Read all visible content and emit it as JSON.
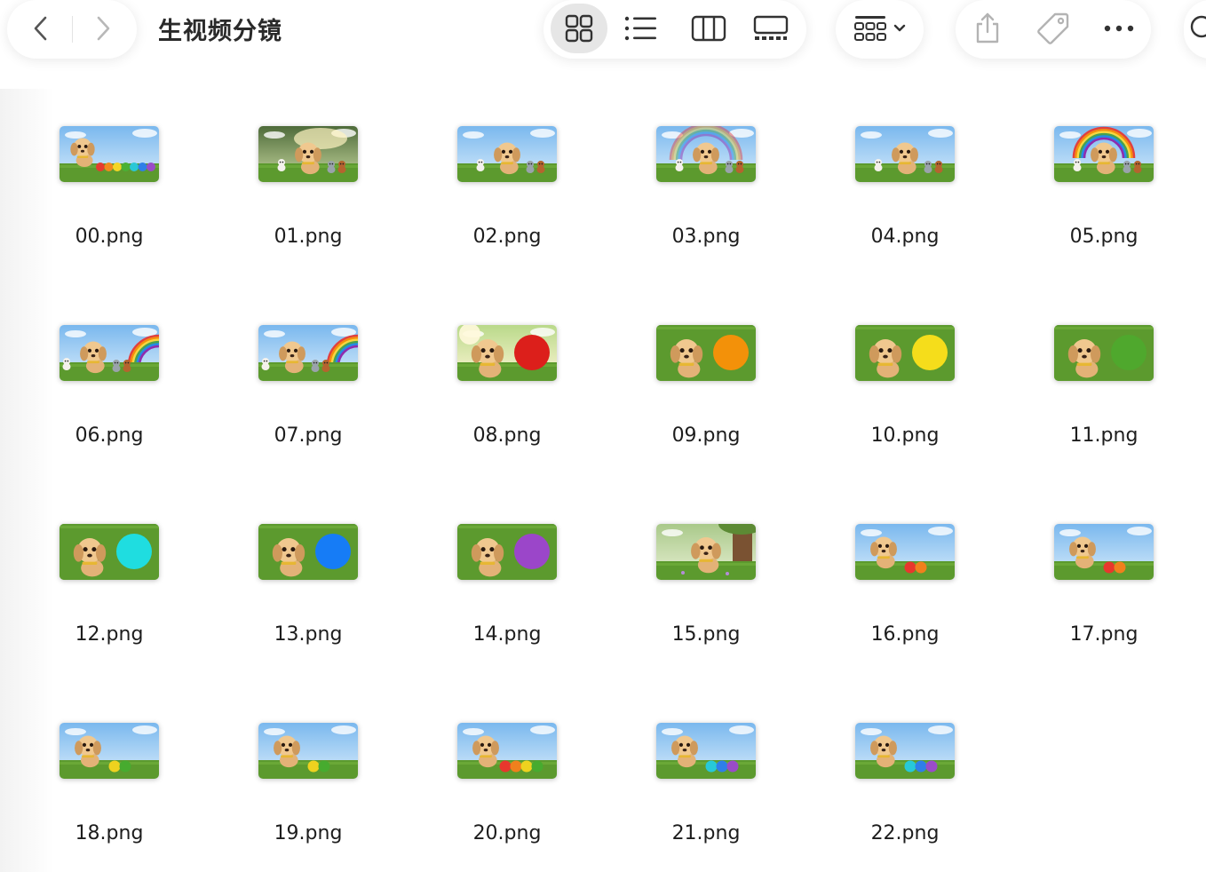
{
  "window": {
    "title": "生视频分镜"
  },
  "toolbar": {
    "nav": [
      "chevron-left-icon",
      "chevron-right-icon"
    ],
    "views": [
      "icon-view-grid-icon",
      "list-view-icon",
      "column-view-icon",
      "gallery-view-icon"
    ],
    "active_view": "icon-view-grid-icon",
    "group": "group-by-icon",
    "actions": [
      "share-icon",
      "tag-icon",
      "more-icon"
    ],
    "search": "search-icon"
  },
  "colors": {
    "sky": "#7ab8ee",
    "grass": "#5c9a2e",
    "puppy": "#e3b277",
    "red": "#dc1f1b",
    "orange": "#f39109",
    "yellow": "#f5dd1b",
    "green": "#4fa82d",
    "cyan": "#1fdde0",
    "blue": "#167cf6",
    "purple": "#9b46c9"
  },
  "files": [
    {
      "name": "00.png",
      "scene": "sky",
      "balls": [
        "#e63b2e",
        "#f08a1c",
        "#f4d624",
        "#4ab135",
        "#2ac8d6",
        "#2f7fe8",
        "#9a4cc8"
      ]
    },
    {
      "name": "01.png",
      "scene": "forest",
      "balls": []
    },
    {
      "name": "02.png",
      "scene": "friends",
      "balls": []
    },
    {
      "name": "03.png",
      "scene": "rainbow-faint",
      "balls": []
    },
    {
      "name": "04.png",
      "scene": "friends",
      "balls": []
    },
    {
      "name": "05.png",
      "scene": "rainbow",
      "balls": []
    },
    {
      "name": "06.png",
      "scene": "rainbow-side",
      "balls": []
    },
    {
      "name": "07.png",
      "scene": "rainbow-side",
      "balls": []
    },
    {
      "name": "08.png",
      "scene": "sunny",
      "balls": [
        "#dc1f1b"
      ]
    },
    {
      "name": "09.png",
      "scene": "grass",
      "balls": [
        "#f39109"
      ]
    },
    {
      "name": "10.png",
      "scene": "grass",
      "balls": [
        "#f5dd1b"
      ]
    },
    {
      "name": "11.png",
      "scene": "grass",
      "balls": [
        "#4fa82d"
      ]
    },
    {
      "name": "12.png",
      "scene": "grass",
      "balls": [
        "#1fdde0"
      ]
    },
    {
      "name": "13.png",
      "scene": "grass",
      "balls": [
        "#167cf6"
      ]
    },
    {
      "name": "14.png",
      "scene": "grass",
      "balls": [
        "#9b46c9"
      ]
    },
    {
      "name": "15.png",
      "scene": "tree",
      "balls": []
    },
    {
      "name": "16.png",
      "scene": "sky",
      "balls": [
        "#e8372d",
        "#f0801d"
      ]
    },
    {
      "name": "17.png",
      "scene": "sky",
      "balls": [
        "#e8372d",
        "#f0801d"
      ]
    },
    {
      "name": "18.png",
      "scene": "sky",
      "balls": [
        "#eed21f",
        "#47ab2f"
      ]
    },
    {
      "name": "19.png",
      "scene": "sky",
      "balls": [
        "#eed21f",
        "#47ab2f"
      ]
    },
    {
      "name": "20.png",
      "scene": "sky",
      "balls": [
        "#e8372d",
        "#f0801d",
        "#eed21f",
        "#47ab2f"
      ]
    },
    {
      "name": "21.png",
      "scene": "sky",
      "balls": [
        "#27c9d8",
        "#2f7fe8",
        "#9a4cc8"
      ]
    },
    {
      "name": "22.png",
      "scene": "sky",
      "balls": [
        "#27c9d8",
        "#2f7fe8",
        "#9a4cc8"
      ]
    }
  ]
}
